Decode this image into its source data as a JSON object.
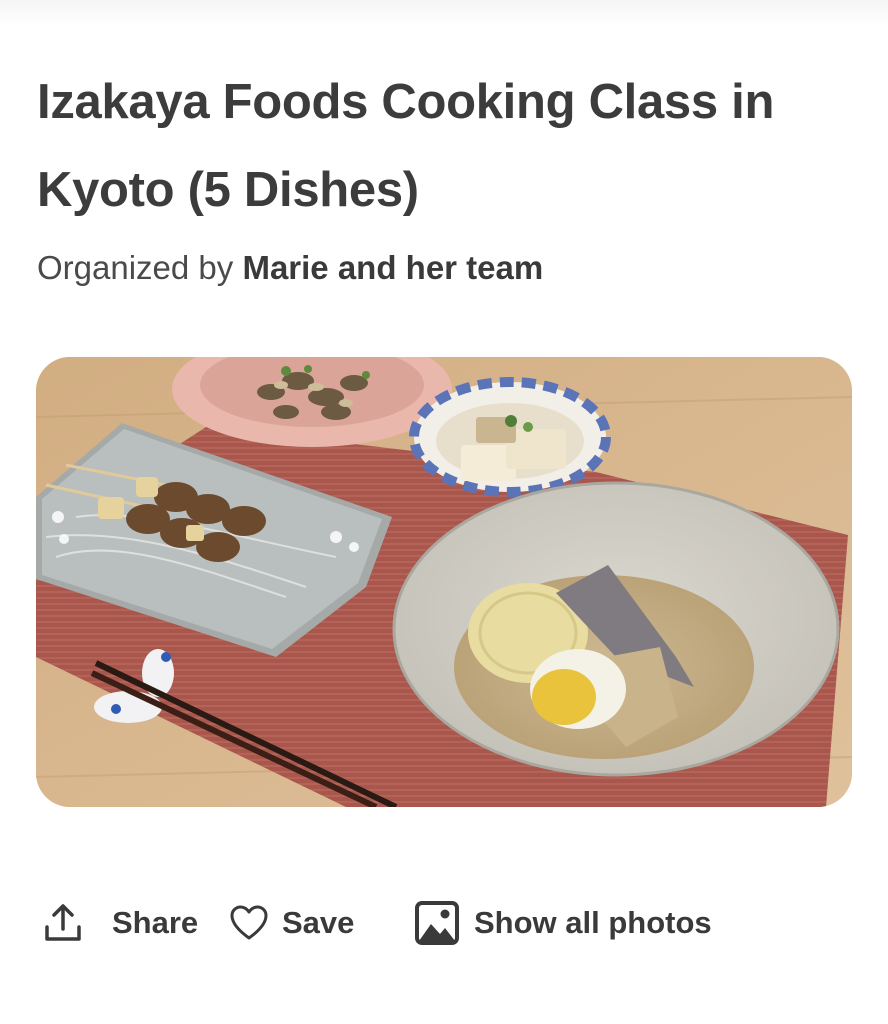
{
  "listing": {
    "title": "Izakaya Foods Cooking Class in Kyoto (5 Dishes)",
    "organizer_prefix": "Organized by ",
    "organizer_name": "Marie and her team"
  },
  "actions": {
    "share_label": "Share",
    "save_label": "Save",
    "show_photos_label": "Show all photos",
    "share_icon": "share-upload-icon",
    "save_icon": "heart-icon",
    "photos_icon": "image-icon"
  },
  "colors": {
    "text": "#3a3a3a",
    "background": "#ffffff"
  }
}
